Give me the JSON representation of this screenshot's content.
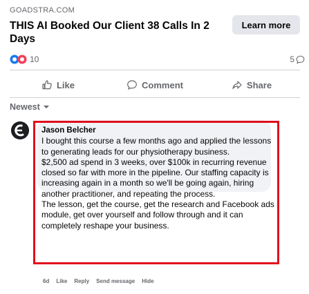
{
  "ad": {
    "domain": "GOADSTRA.COM",
    "headline": "THIS AI Booked Our Client 38 Calls In 2 Days",
    "cta_label": "Learn more"
  },
  "stats": {
    "reaction_count": "10",
    "comment_count": "5"
  },
  "actions": {
    "like": "Like",
    "comment": "Comment",
    "share": "Share"
  },
  "sort": {
    "label": "Newest"
  },
  "comment": {
    "author": "Jason Belcher",
    "paragraphs": [
      "I bought this course a few months ago and applied the lessons to generating leads for our physiotherapy business.",
      "$2,500 ad spend in 3 weeks, over $100k in recurring revenue closed so far with more in the pipeline. Our staffing capacity is increasing again in a month so we'll be going again, hiring another practitioner, and repeating the process.",
      "The lesson, get the course, get the research and Facebook ads module, get over yourself and follow through and it can completely reshape your business."
    ],
    "action_links": [
      "6d",
      "Like",
      "Reply",
      "Send message",
      "Hide"
    ]
  },
  "colors": {
    "accent_red": "#e00d1c",
    "like_blue": "#1877f2",
    "love_red": "#f33e58",
    "muted": "#65676b"
  },
  "icons": {
    "reactions": [
      "like-reaction-icon",
      "love-reaction-icon"
    ],
    "comment_count": "comment-bubble-icon",
    "like": "thumbs-up-icon",
    "comment": "speech-bubble-icon",
    "share": "share-arrow-icon",
    "sort": "chevron-down-icon"
  }
}
